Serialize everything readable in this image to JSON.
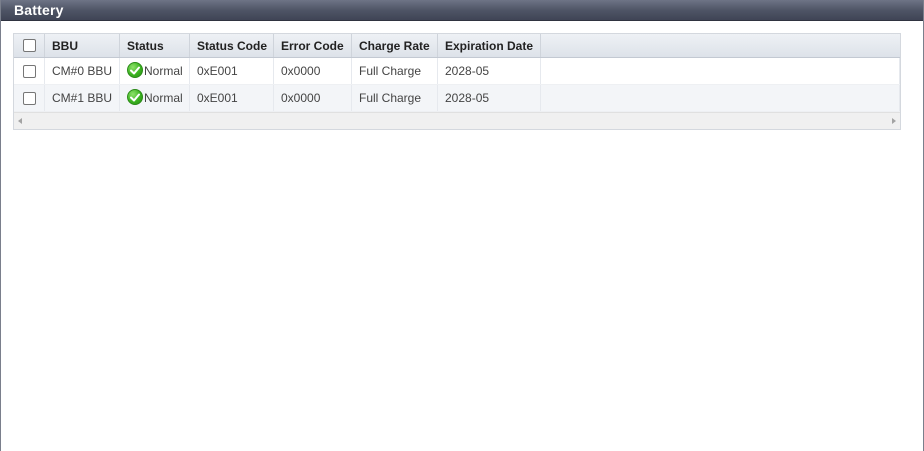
{
  "panel": {
    "title": "Battery"
  },
  "table": {
    "columns": [
      "BBU",
      "Status",
      "Status Code",
      "Error Code",
      "Charge Rate",
      "Expiration Date"
    ],
    "rows": [
      {
        "bbu": "CM#0 BBU",
        "status": "Normal",
        "status_icon": "check-circle-icon",
        "status_code": "0xE001",
        "error_code": "0x0000",
        "charge_rate": "Full Charge",
        "expiration_date": "2028-05",
        "checked": false
      },
      {
        "bbu": "CM#1 BBU",
        "status": "Normal",
        "status_icon": "check-circle-icon",
        "status_code": "0xE001",
        "error_code": "0x0000",
        "charge_rate": "Full Charge",
        "expiration_date": "2028-05",
        "checked": false
      }
    ]
  },
  "colors": {
    "header_bar": "#4f5566",
    "status_ok": "#3bb320"
  }
}
